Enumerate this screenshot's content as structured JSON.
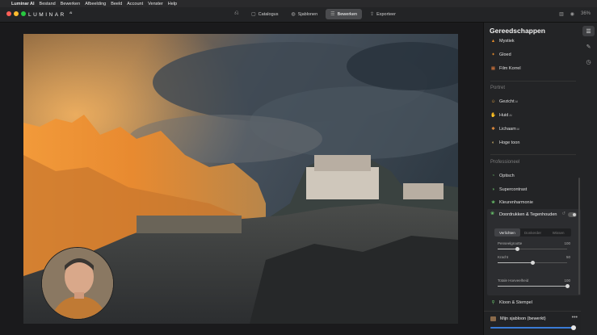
{
  "menubar": {
    "apple": "",
    "app_name": "Luminar AI",
    "items": [
      "Bestand",
      "Bewerken",
      "Afbeelding",
      "Beeld",
      "Account",
      "Venster",
      "Help"
    ]
  },
  "titlebar": {
    "logo": "LUMINAR",
    "logo_sup": "AI",
    "tabs": [
      {
        "label": "Catalogus",
        "icon": "catalog-icon",
        "glyph": "▢"
      },
      {
        "label": "Sjablonen",
        "icon": "templates-icon",
        "glyph": "◍"
      },
      {
        "label": "Bewerken",
        "icon": "edit-icon",
        "glyph": "☰"
      },
      {
        "label": "Exporteer",
        "icon": "export-icon",
        "glyph": "⇪"
      }
    ],
    "active_tab": 2,
    "zoom": "36%"
  },
  "panel": {
    "title": "Gereedschappen",
    "items_top": [
      {
        "label": "Mystiek",
        "icon": "mystical-icon",
        "color": "#e08a2c",
        "glyph": "▲",
        "sup": ""
      },
      {
        "label": "Gloed",
        "icon": "glow-icon",
        "color": "#e08a2c",
        "glyph": "✦",
        "sup": ""
      },
      {
        "label": "Film Korrel",
        "icon": "film-grain-icon",
        "color": "#e07a3c",
        "glyph": "▦",
        "sup": ""
      }
    ],
    "section_portret": "Portret",
    "items_portret": [
      {
        "label": "Gezicht",
        "icon": "face-icon",
        "color": "#e0a040",
        "glyph": "☺",
        "sup": "AI"
      },
      {
        "label": "Huid",
        "icon": "skin-icon",
        "color": "#e09a3c",
        "glyph": "✋",
        "sup": "AI"
      },
      {
        "label": "Lichaam",
        "icon": "body-icon",
        "color": "#e08a3c",
        "glyph": "✱",
        "sup": "AI"
      },
      {
        "label": "Hoge toon",
        "icon": "high-key-icon",
        "color": "#e0c070",
        "glyph": "◐",
        "sup": ""
      }
    ],
    "section_pro": "Professioneel",
    "items_pro": [
      {
        "label": "Optisch",
        "icon": "optical-icon",
        "color": "#6cc46c",
        "glyph": "◔",
        "sup": ""
      },
      {
        "label": "Supercontrast",
        "icon": "supercontrast-icon",
        "color": "#6cc46c",
        "glyph": "◑",
        "sup": ""
      },
      {
        "label": "Kleurenharmonie",
        "icon": "color-harmony-icon",
        "color": "#6cc46c",
        "glyph": "❀",
        "sup": ""
      }
    ],
    "expanded_tool": {
      "label": "Doordrukken & Tegenhouden",
      "icon": "dodge-burn-icon",
      "segments": [
        "Verlichten",
        "Donkerder",
        "Wissen"
      ],
      "active_segment": 0,
      "sliders": [
        {
          "label": "Penseelgrootte",
          "value": "100",
          "fraction": 0.28
        },
        {
          "label": "Kracht",
          "value": "50",
          "fraction": 0.5
        },
        {
          "label": "Totale Hoeveelheid",
          "value": "100",
          "fraction": 1.0
        }
      ]
    },
    "item_clone": {
      "label": "Kloon & Stempel",
      "icon": "clone-stamp-icon",
      "color": "#6cc46c",
      "glyph": "⚲"
    },
    "template": {
      "label": "Mijn sjabloon (bewerkt)",
      "more": "•••",
      "fraction": 0.97
    }
  },
  "toolcol": [
    "sliders-icon",
    "brush-icon",
    "history-icon"
  ]
}
